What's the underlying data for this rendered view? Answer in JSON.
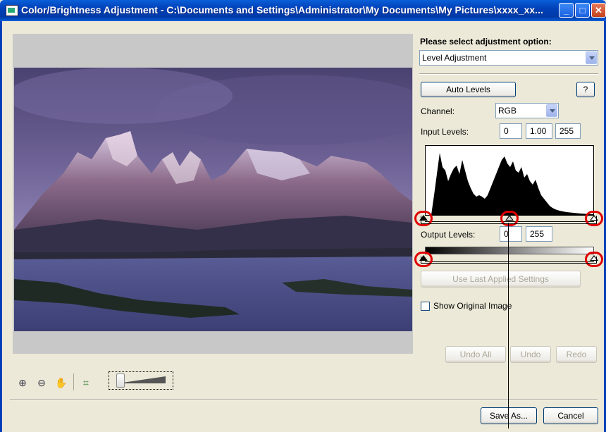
{
  "window": {
    "title": "Color/Brightness Adjustment - C:\\Documents and Settings\\Administrator\\My Documents\\My Pictures\\xxxx_xx...",
    "buttons": {
      "minimize": "_",
      "maximize": "□",
      "close": "✕"
    }
  },
  "options": {
    "prompt": "Please select adjustment option:",
    "selected": "Level Adjustment"
  },
  "levels": {
    "auto_levels": "Auto Levels",
    "help": "?",
    "channel_label": "Channel:",
    "channel_value": "RGB",
    "input_label": "Input Levels:",
    "input_black": "0",
    "input_gamma": "1.00",
    "input_white": "255",
    "output_label": "Output Levels:",
    "output_black": "0",
    "output_white": "255",
    "use_last": "Use Last Applied Settings",
    "show_original": "Show Original Image"
  },
  "history": {
    "undo_all": "Undo All",
    "undo": "Undo",
    "redo": "Redo"
  },
  "footer": {
    "save_as": "Save As...",
    "cancel": "Cancel"
  },
  "toolbar": {
    "icons": [
      "zoom-in-icon",
      "zoom-out-icon",
      "hand-icon",
      "fit-window-icon"
    ],
    "zoom_slider_position": 0
  },
  "colors": {
    "title_bar": "#0040b8",
    "marker": "#e00000",
    "dialog_bg": "#ece9d8"
  }
}
